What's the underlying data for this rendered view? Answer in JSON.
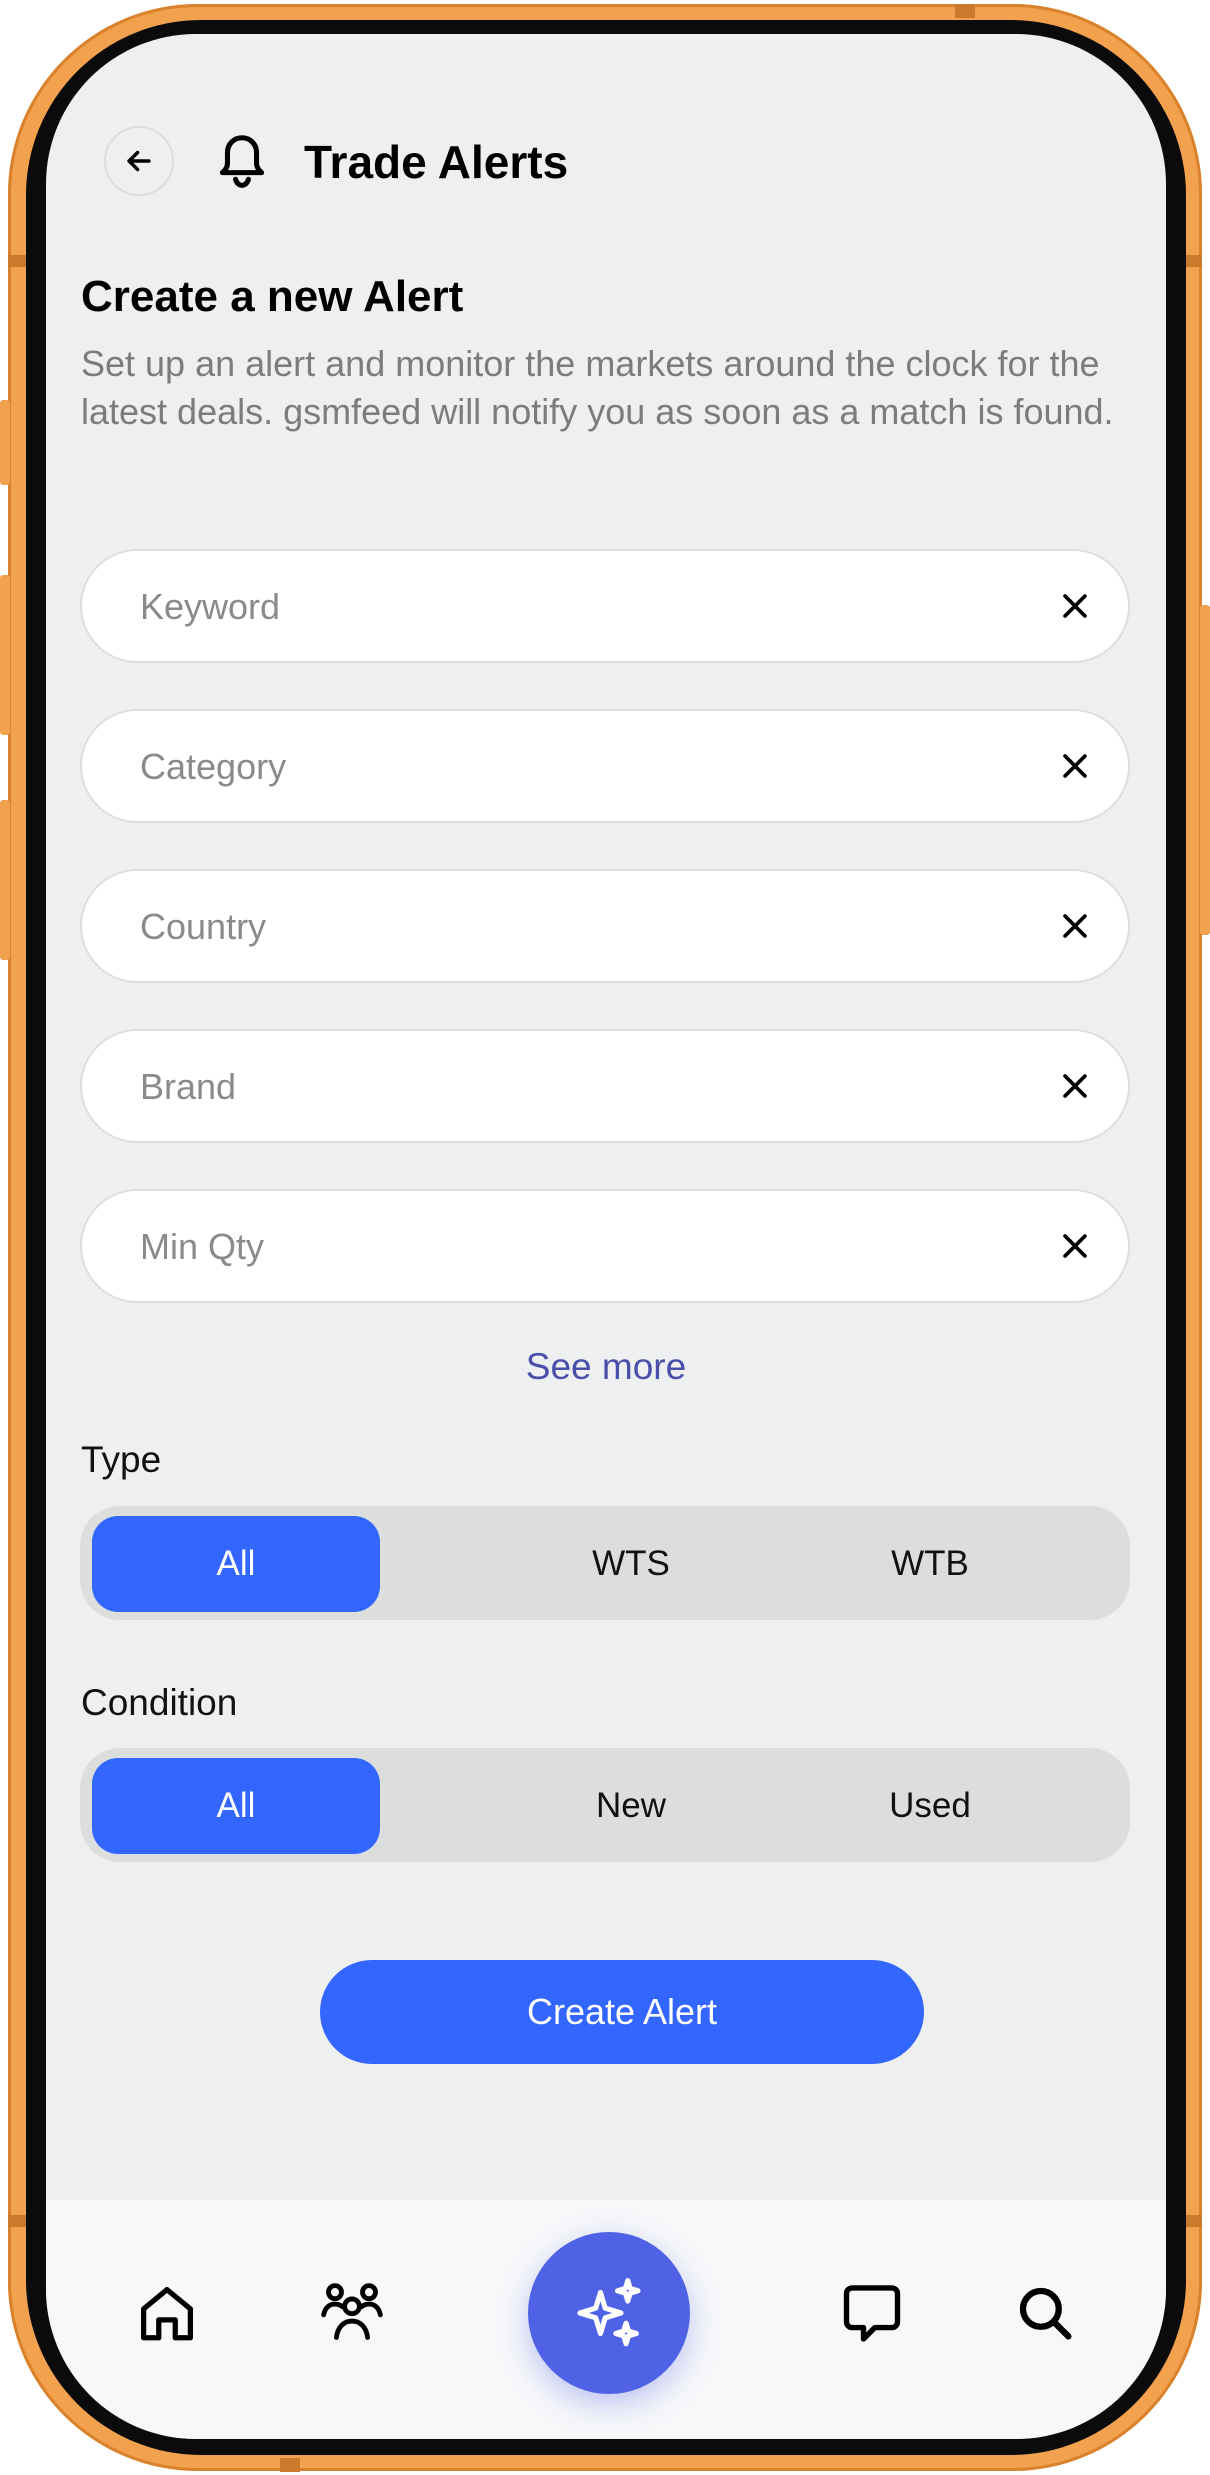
{
  "header": {
    "title": "Trade Alerts",
    "back_icon": "arrow-left-icon",
    "bell_icon": "bell-icon"
  },
  "page": {
    "title": "Create a new Alert",
    "subtitle": "Set up an alert and monitor the markets around the clock for the latest deals. gsmfeed will notify you as soon as a match is found."
  },
  "fields": [
    {
      "placeholder": "Keyword",
      "value": ""
    },
    {
      "placeholder": "Category",
      "value": ""
    },
    {
      "placeholder": "Country",
      "value": ""
    },
    {
      "placeholder": "Brand",
      "value": ""
    },
    {
      "placeholder": "Min Qty",
      "value": ""
    }
  ],
  "see_more": "See more",
  "type": {
    "label": "Type",
    "options": [
      "All",
      "WTS",
      "WTB"
    ],
    "selected": "All"
  },
  "condition": {
    "label": "Condition",
    "options": [
      "All",
      "New",
      "Used"
    ],
    "selected": "All"
  },
  "create_button": "Create Alert",
  "bottom_nav": {
    "items": [
      "home-icon",
      "people-icon",
      "sparkles-icon",
      "chat-icon",
      "search-icon"
    ],
    "active": "sparkles-icon"
  },
  "colors": {
    "accent": "#3366ff",
    "link": "#4a4faa",
    "fab": "#4f62e6",
    "frame": "#f2a14f"
  }
}
